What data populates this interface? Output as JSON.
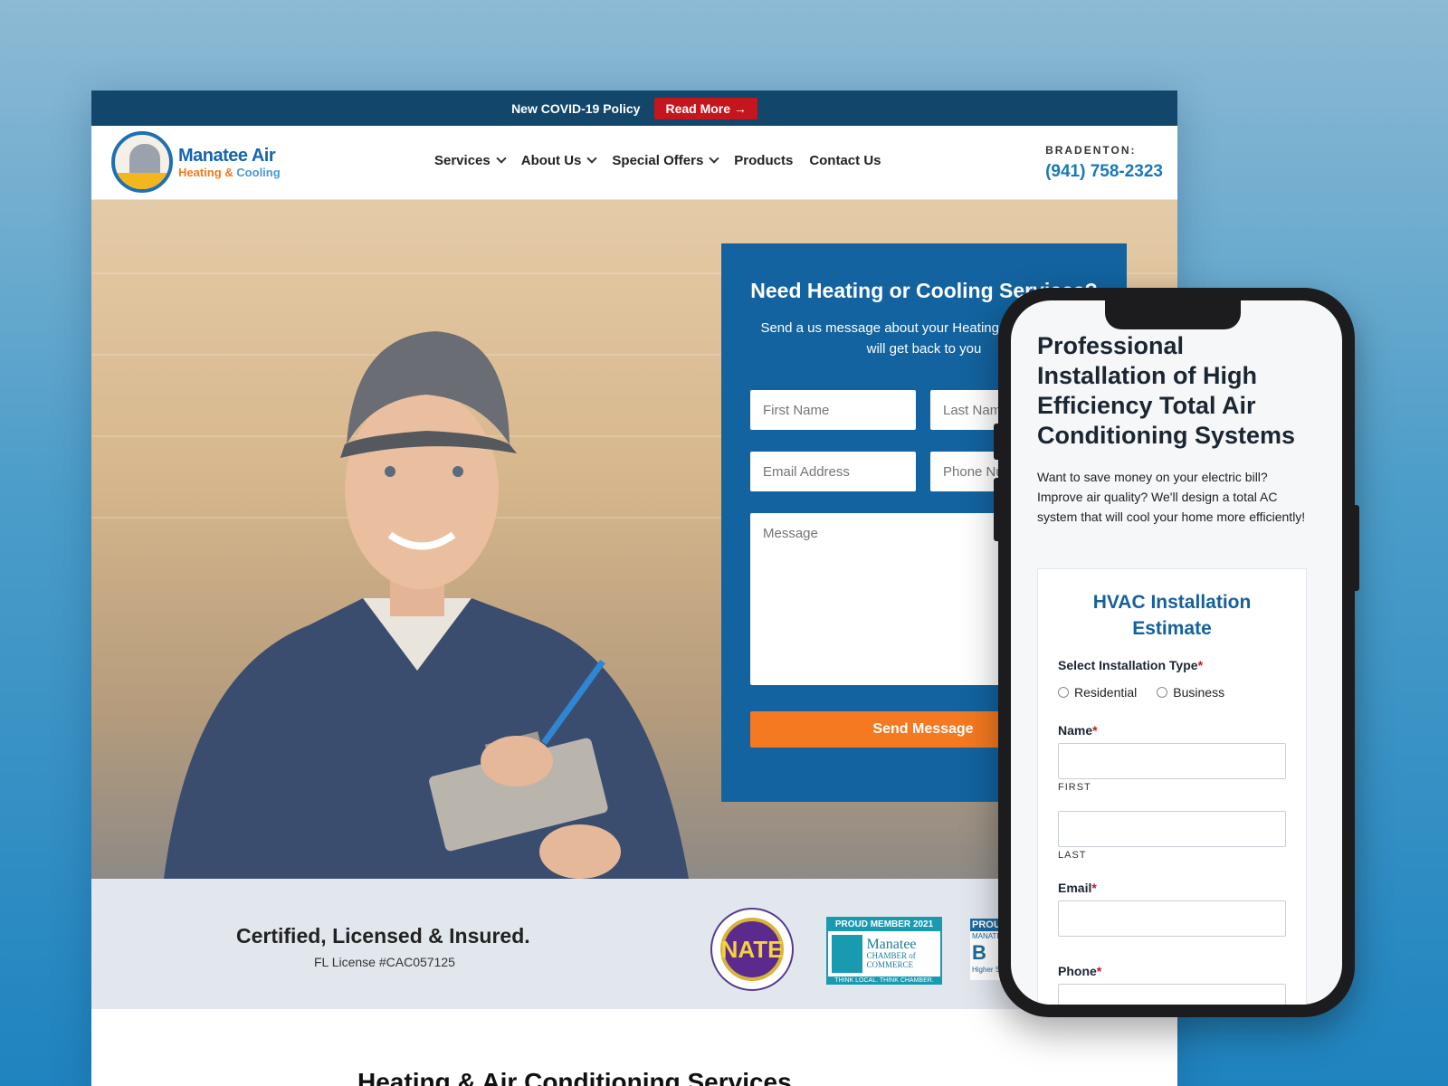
{
  "topbar": {
    "policy_text": "New COVID-19 Policy",
    "read_more": "Read More →"
  },
  "logo": {
    "line1": "Manatee Air",
    "line2_a": "Heating",
    "line2_amp": " & ",
    "line2_b": "Cooling"
  },
  "nav": {
    "items": [
      {
        "label": "Services",
        "dropdown": true
      },
      {
        "label": "About Us",
        "dropdown": true
      },
      {
        "label": "Special Offers",
        "dropdown": true
      },
      {
        "label": "Products",
        "dropdown": false
      },
      {
        "label": "Contact Us",
        "dropdown": false
      }
    ]
  },
  "contact": {
    "location": "BRADENTON:",
    "phone": "(941) 758-2323"
  },
  "form": {
    "title": "Need Heating or Cooling Services?",
    "subtitle": "Send a us message about your Heating needs and we will get back to you",
    "first_name": "First Name",
    "last_name": "Last Name",
    "email": "Email Address",
    "phone": "Phone Number",
    "message": "Message",
    "send": "Send Message"
  },
  "certs": {
    "heading": "Certified, Licensed & Insured.",
    "license": "FL License #CAC057125",
    "nate": "NATE",
    "chamber_top": "PROUD MEMBER 2021",
    "chamber_name": "Manatee",
    "chamber_sub": "CHAMBER of COMMERCE",
    "chamber_tag": "THINK LOCAL. THINK CHAMBER.",
    "bbb_top": "PROUD",
    "bbb_sub": "MANATEE",
    "bbb_big": "B",
    "bbb_tag": "Higher S"
  },
  "section": {
    "heading": "Heating & Air Conditioning Services"
  },
  "mobile": {
    "title": "Professional Installation of High Efficiency Total Air Conditioning Systems",
    "intro": "Want to save money on your electric bill? Improve air quality?  We'll design a total AC system that will cool your home more efficiently!",
    "estimate_title": "HVAC Installation Estimate",
    "install_type_label": "Select Installation Type",
    "radio_residential": "Residential",
    "radio_business": "Business",
    "name_label": "Name",
    "first": "FIRST",
    "last": "LAST",
    "email_label": "Email",
    "phone_label": "Phone",
    "required_mark": "*"
  },
  "colors": {
    "topbar": "#12476b",
    "accent_red": "#c4161c",
    "form_blue": "#12639f",
    "send_orange": "#f47920",
    "phone_blue": "#1a78b8"
  }
}
